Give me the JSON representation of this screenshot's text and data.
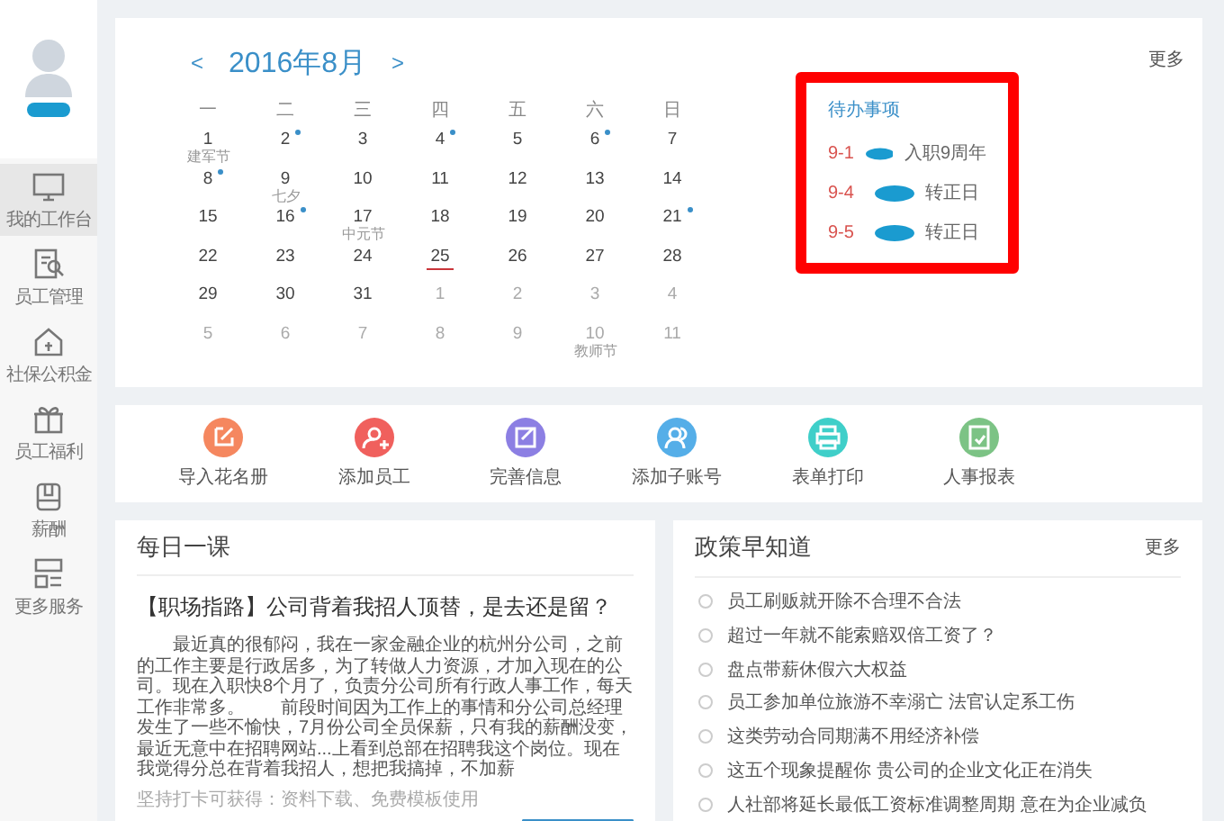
{
  "sidebar": {
    "items": [
      {
        "label": "我的工作台",
        "selected": true
      },
      {
        "label": "员工管理",
        "selected": false
      },
      {
        "label": "社保公积金",
        "selected": false
      },
      {
        "label": "员工福利",
        "selected": false
      },
      {
        "label": "薪酬",
        "selected": false
      },
      {
        "label": "更多服务",
        "selected": false
      }
    ]
  },
  "calendar": {
    "prev": "<",
    "title": "2016年8月",
    "next": ">",
    "more": "更多",
    "weekdays": [
      "一",
      "二",
      "三",
      "四",
      "五",
      "六",
      "日"
    ],
    "days": [
      {
        "day": "1",
        "muted": false,
        "dot": false,
        "today": false,
        "note": "建军节"
      },
      {
        "day": "2",
        "muted": false,
        "dot": true,
        "today": false
      },
      {
        "day": "3",
        "muted": false,
        "dot": false,
        "today": false
      },
      {
        "day": "4",
        "muted": false,
        "dot": true,
        "today": false
      },
      {
        "day": "5",
        "muted": false,
        "dot": false,
        "today": false
      },
      {
        "day": "6",
        "muted": false,
        "dot": true,
        "today": false
      },
      {
        "day": "7",
        "muted": false,
        "dot": false,
        "today": false
      },
      {
        "day": "8",
        "muted": false,
        "dot": true,
        "today": false
      },
      {
        "day": "9",
        "muted": false,
        "dot": false,
        "today": false,
        "note": "七夕"
      },
      {
        "day": "10",
        "muted": false,
        "dot": false,
        "today": false
      },
      {
        "day": "11",
        "muted": false,
        "dot": false,
        "today": false
      },
      {
        "day": "12",
        "muted": false,
        "dot": false,
        "today": false
      },
      {
        "day": "13",
        "muted": false,
        "dot": false,
        "today": false
      },
      {
        "day": "14",
        "muted": false,
        "dot": false,
        "today": false
      },
      {
        "day": "15",
        "muted": false,
        "dot": false,
        "today": false
      },
      {
        "day": "16",
        "muted": false,
        "dot": true,
        "today": false
      },
      {
        "day": "17",
        "muted": false,
        "dot": false,
        "today": false,
        "note": "中元节"
      },
      {
        "day": "18",
        "muted": false,
        "dot": false,
        "today": false
      },
      {
        "day": "19",
        "muted": false,
        "dot": false,
        "today": false
      },
      {
        "day": "20",
        "muted": false,
        "dot": false,
        "today": false
      },
      {
        "day": "21",
        "muted": false,
        "dot": true,
        "today": false
      },
      {
        "day": "22",
        "muted": false,
        "dot": false,
        "today": false
      },
      {
        "day": "23",
        "muted": false,
        "dot": false,
        "today": false
      },
      {
        "day": "24",
        "muted": false,
        "dot": false,
        "today": false
      },
      {
        "day": "25",
        "muted": false,
        "dot": false,
        "today": true
      },
      {
        "day": "26",
        "muted": false,
        "dot": false,
        "today": false
      },
      {
        "day": "27",
        "muted": false,
        "dot": false,
        "today": false
      },
      {
        "day": "28",
        "muted": false,
        "dot": false,
        "today": false
      },
      {
        "day": "29",
        "muted": false,
        "dot": false,
        "today": false
      },
      {
        "day": "30",
        "muted": false,
        "dot": false,
        "today": false
      },
      {
        "day": "31",
        "muted": false,
        "dot": false,
        "today": false
      },
      {
        "day": "1",
        "muted": true,
        "dot": false,
        "today": false
      },
      {
        "day": "2",
        "muted": true,
        "dot": false,
        "today": false
      },
      {
        "day": "3",
        "muted": true,
        "dot": false,
        "today": false
      },
      {
        "day": "4",
        "muted": true,
        "dot": false,
        "today": false
      },
      {
        "day": "5",
        "muted": true,
        "dot": false,
        "today": false
      },
      {
        "day": "6",
        "muted": true,
        "dot": false,
        "today": false
      },
      {
        "day": "7",
        "muted": true,
        "dot": false,
        "today": false
      },
      {
        "day": "8",
        "muted": true,
        "dot": false,
        "today": false
      },
      {
        "day": "9",
        "muted": true,
        "dot": false,
        "today": false
      },
      {
        "day": "10",
        "muted": true,
        "dot": false,
        "today": false,
        "note": "教师节"
      },
      {
        "day": "11",
        "muted": true,
        "dot": false,
        "today": false
      }
    ]
  },
  "todo": {
    "title": "待办事项",
    "highlighted": true,
    "items": [
      {
        "date": "9-1",
        "text": "入职9周年"
      },
      {
        "date": "9-4",
        "text": "转正日"
      },
      {
        "date": "9-5",
        "text": "转正日"
      }
    ]
  },
  "shortcuts": [
    {
      "label": "导入花名册",
      "color": "#f5875f"
    },
    {
      "label": "添加员工",
      "color": "#f0605d"
    },
    {
      "label": "完善信息",
      "color": "#8c7fe3"
    },
    {
      "label": "添加子账号",
      "color": "#55aee8"
    },
    {
      "label": "表单打印",
      "color": "#3fcfc9"
    },
    {
      "label": "人事报表",
      "color": "#7cc385"
    }
  ],
  "lesson": {
    "title": "每日一课",
    "headline": "【职场指路】公司背着我招人顶替，是去还是留？",
    "body": "最近真的很郁闷，我在一家金融企业的杭州分公司，之前的工作主要是行政居多，为了转做人力资源，才加入现在的公司。现在入职快8个月了，负责分公司所有行政人事工作，每天工作非常多。　　前段时间因为工作上的事情和分公司总经理发生了一些不愉快，7月份公司全员保薪，只有我的薪酬没变，最近无意中在招聘网站...上看到总部在招聘我这个岗位。现在我觉得分总在背着我招人，想把我搞掉，不加薪",
    "footnote": "坚持打卡可获得：资料下载、免费模板使用"
  },
  "policy": {
    "title": "政策早知道",
    "more": "更多",
    "items": [
      "员工刷贩就开除不合理不合法",
      "超过一年就不能索赔双倍工资了？",
      "盘点带薪休假六大权益",
      "员工参加单位旅游不幸溺亡 法官认定系工伤",
      "这类劳动合同期满不用经济补偿",
      "这五个现象提醒你 贵公司的企业文化正在消失",
      "人社部将延长最低工资标准调整周期 意在为企业减负"
    ]
  }
}
